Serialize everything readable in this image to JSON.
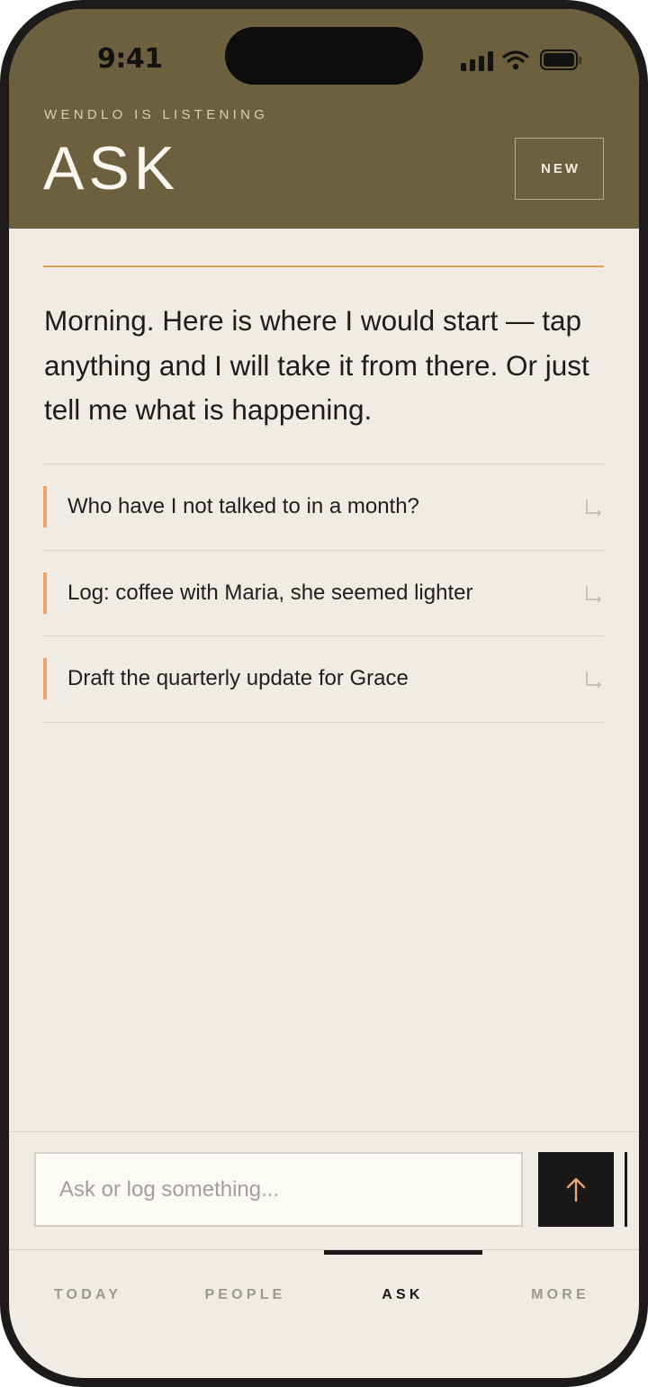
{
  "status_bar": {
    "time": "9:41",
    "icons": [
      "cellular-signal-icon",
      "wifi-icon",
      "battery-icon"
    ]
  },
  "header": {
    "kicker": "WENDLO IS LISTENING",
    "title": "ASK",
    "new_button_label": "NEW"
  },
  "intro": {
    "message": "Morning. Here is where I would start — tap anything and I will take it from there. Or just tell me what is happening."
  },
  "suggestions": [
    {
      "label": "Who have I not talked to in a month?",
      "icon": "reply-arrow-icon"
    },
    {
      "label": "Log: coffee with Maria, she seemed lighter",
      "icon": "reply-arrow-icon"
    },
    {
      "label": "Draft the quarterly update for Grace",
      "icon": "reply-arrow-icon"
    }
  ],
  "composer": {
    "value": "",
    "placeholder": "Ask or log something...",
    "send_icon": "arrow-up-icon"
  },
  "tabs": [
    {
      "label": "TODAY",
      "active": false
    },
    {
      "label": "PEOPLE",
      "active": false
    },
    {
      "label": "ASK",
      "active": true
    },
    {
      "label": "MORE",
      "active": false
    }
  ],
  "colors": {
    "header_bg": "#6c603e",
    "page_bg": "#f0ebe3",
    "accent_rule": "#d8a55a",
    "suggestion_bar": "#eaa56f",
    "send_button_bg": "#181818",
    "send_arrow": "#eaa56f",
    "active_tab": "#1a1a1a",
    "inactive_tab": "#9d998f"
  }
}
